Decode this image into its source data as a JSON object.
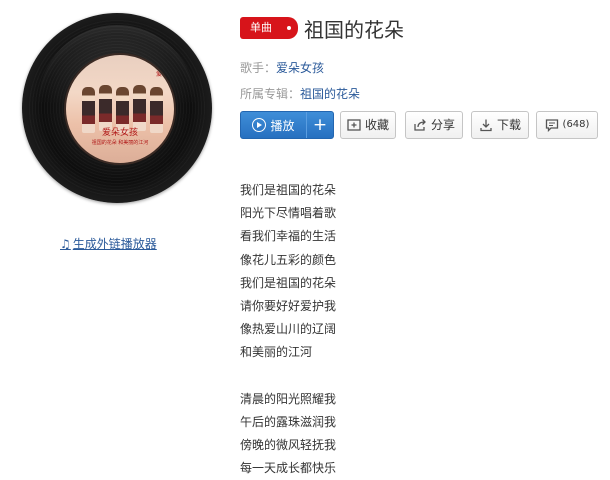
{
  "album_art": {
    "cover_title": "爱朵女孩",
    "cover_subtitle": "祖国的花朵 和美丽的江河",
    "cover_corner": "爱朵"
  },
  "external_player_link": "生成外链播放器",
  "song": {
    "tag": "单曲",
    "title": "祖国的花朵",
    "singer_label": "歌手：",
    "singer": "爱朵女孩",
    "album_label": "所属专辑：",
    "album": "祖国的花朵"
  },
  "actions": {
    "play": "播放",
    "add": "+",
    "favorite": "收藏",
    "share": "分享",
    "download": "下载",
    "comments": "(648)"
  },
  "colors": {
    "accent_blue": "#2b7ad0",
    "tag_red": "#d7141a",
    "link": "#2b5a9a"
  },
  "lyrics": {
    "verse1": [
      "我们是祖国的花朵",
      "阳光下尽情唱着歌",
      "看我们幸福的生活",
      "像花儿五彩的颜色",
      "我们是祖国的花朵",
      "请你要好好爱护我",
      "像热爱山川的辽阔",
      "和美丽的江河"
    ],
    "verse2": [
      "清晨的阳光照耀我",
      "午后的露珠滋润我",
      "傍晚的微风轻抚我",
      "每一天成长都快乐"
    ]
  }
}
